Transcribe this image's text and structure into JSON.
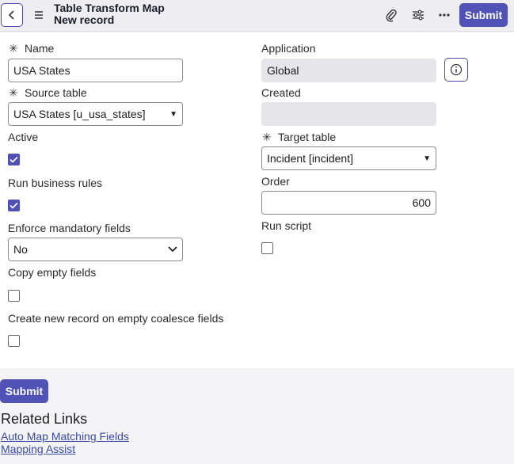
{
  "header": {
    "title": "Table Transform Map",
    "subtitle": "New record",
    "submit_label": "Submit",
    "icons": [
      "back-icon",
      "menu-icon",
      "attachment-icon",
      "settings-sliders-icon",
      "more-icon"
    ]
  },
  "form": {
    "name": {
      "label": "Name",
      "value": "USA States",
      "required": true
    },
    "source_table": {
      "label": "Source table",
      "value": "USA States [u_usa_states]",
      "required": true
    },
    "active": {
      "label": "Active",
      "checked": true
    },
    "run_business_rules": {
      "label": "Run business rules",
      "checked": true
    },
    "enforce_mandatory": {
      "label": "Enforce mandatory fields",
      "value": "No"
    },
    "copy_empty": {
      "label": "Copy empty fields",
      "checked": false
    },
    "create_new_record": {
      "label": "Create new record on empty coalesce fields",
      "checked": false
    },
    "application": {
      "label": "Application",
      "value": "Global"
    },
    "created": {
      "label": "Created",
      "value": ""
    },
    "target_table": {
      "label": "Target table",
      "value": "Incident [incident]",
      "required": true
    },
    "order": {
      "label": "Order",
      "value": "600"
    },
    "run_script": {
      "label": "Run script",
      "checked": false
    },
    "required_marker": "✳"
  },
  "footer": {
    "submit_label": "Submit",
    "related_links_title": "Related Links",
    "links": [
      "Auto Map Matching Fields",
      "Mapping Assist"
    ]
  },
  "colors": {
    "accent": "#5052b5",
    "link": "#3a4aa8"
  }
}
